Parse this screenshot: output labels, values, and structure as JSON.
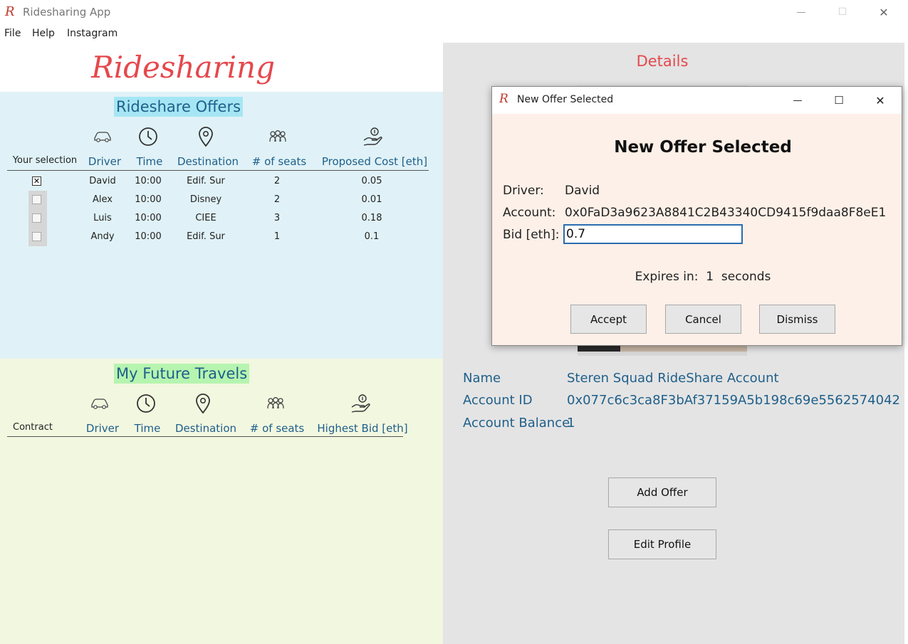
{
  "window": {
    "title": "Ridesharing App",
    "logo_glyph": "R",
    "controls": {
      "minimize": "—",
      "maximize": "☐",
      "close": "✕"
    }
  },
  "menu": [
    "File",
    "Help",
    "Instagram"
  ],
  "brand": "Ridesharing",
  "offers": {
    "heading": "Rideshare Offers",
    "select_label": "Your selection",
    "columns": [
      "Driver",
      "Time",
      "Destination",
      "# of seats",
      "Proposed Cost [eth]"
    ],
    "icons": [
      "car-icon",
      "clock-icon",
      "location-pin-icon",
      "people-icon",
      "hand-coin-icon"
    ],
    "rows": [
      {
        "selected": true,
        "checkbox": "✕",
        "driver": "David",
        "time": "10:00",
        "destination": "Edif. Sur",
        "seats": "2",
        "cost": "0.05"
      },
      {
        "selected": false,
        "checkbox": "",
        "driver": "Alex",
        "time": "10:00",
        "destination": "Disney",
        "seats": "2",
        "cost": "0.01"
      },
      {
        "selected": false,
        "checkbox": "",
        "driver": "Luis",
        "time": "10:00",
        "destination": "CIEE",
        "seats": "3",
        "cost": "0.18"
      },
      {
        "selected": false,
        "checkbox": "",
        "driver": "Andy",
        "time": "10:00",
        "destination": "Edif. Sur",
        "seats": "1",
        "cost": "0.1"
      }
    ]
  },
  "travels": {
    "heading": "My Future Travels",
    "contract_label": "Contract",
    "columns": [
      "Driver",
      "Time",
      "Destination",
      "# of seats",
      "Highest Bid [eth]"
    ],
    "rows": []
  },
  "details": {
    "heading": "Details",
    "name_label": "Name",
    "name_value": "Steren Squad RideShare Account",
    "account_id_label": "Account ID",
    "account_id_value": "0x077c6c3ca8F3bAf37159A5b198c69e5562574042",
    "balance_label": "Account Balance",
    "balance_value": "1",
    "add_offer_button": "Add Offer",
    "edit_profile_button": "Edit Profile"
  },
  "dialog": {
    "window_title": "New Offer Selected",
    "heading": "New Offer Selected",
    "driver_label": "Driver:",
    "driver_value": "David",
    "account_label": "Account:",
    "account_value": "0x0FaD3a9623A8841C2B43340CD9415f9daa8F8eE1",
    "bid_label": "Bid [eth]:",
    "bid_value": "0.7",
    "expires_label": "Expires in:",
    "expires_value": "1",
    "expires_unit": "seconds",
    "accept_button": "Accept",
    "cancel_button": "Cancel",
    "dismiss_button": "Dismiss"
  },
  "colors": {
    "brand": "#e5484d",
    "offers_bg": "#e0f2f7",
    "travels_bg": "#f2f7e0",
    "details_bg": "#e4e4e4",
    "text_blue": "#1e5f8a",
    "dialog_bg": "#fdf0e8"
  }
}
